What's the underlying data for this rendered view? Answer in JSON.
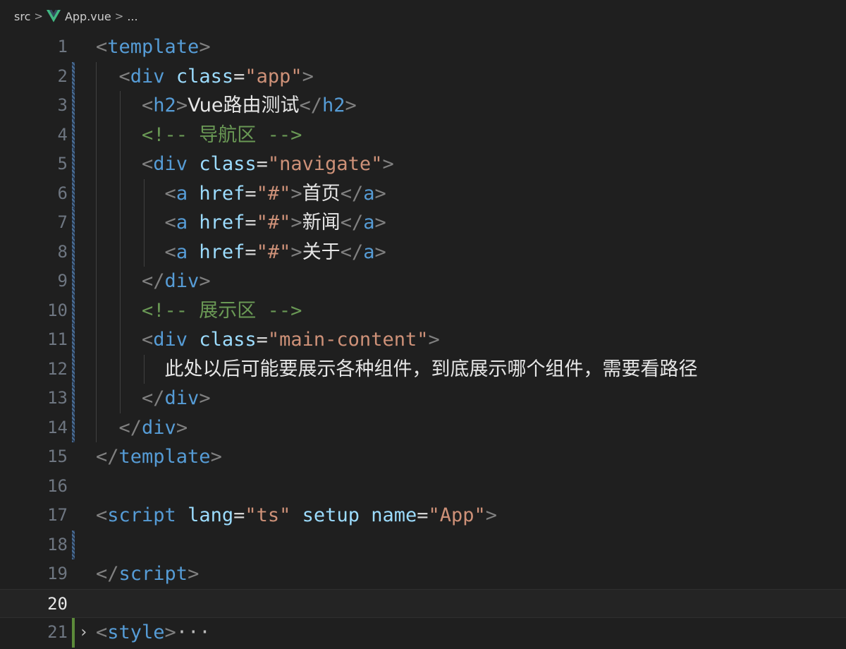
{
  "breadcrumb": {
    "folder": "src",
    "file": "App.vue",
    "more": "..."
  },
  "lines": [
    {
      "n": "1",
      "tokens": [
        [
          "br",
          "<"
        ],
        [
          "tag",
          "template"
        ],
        [
          "br",
          ">"
        ]
      ]
    },
    {
      "n": "2",
      "tokens": [
        [
          "sp",
          "  "
        ],
        [
          "br",
          "<"
        ],
        [
          "tag",
          "div"
        ],
        [
          "sp",
          " "
        ],
        [
          "attr",
          "class"
        ],
        [
          "eq",
          "="
        ],
        [
          "str",
          "\"app\""
        ],
        [
          "br",
          ">"
        ]
      ]
    },
    {
      "n": "3",
      "tokens": [
        [
          "sp",
          "    "
        ],
        [
          "br",
          "<"
        ],
        [
          "tag",
          "h2"
        ],
        [
          "br",
          ">"
        ],
        [
          "txt",
          "Vue路由测试"
        ],
        [
          "br",
          "</"
        ],
        [
          "tag",
          "h2"
        ],
        [
          "br",
          ">"
        ]
      ]
    },
    {
      "n": "4",
      "tokens": [
        [
          "sp",
          "    "
        ],
        [
          "cmt",
          "<!-- 导航区 -->"
        ]
      ]
    },
    {
      "n": "5",
      "tokens": [
        [
          "sp",
          "    "
        ],
        [
          "br",
          "<"
        ],
        [
          "tag",
          "div"
        ],
        [
          "sp",
          " "
        ],
        [
          "attr",
          "class"
        ],
        [
          "eq",
          "="
        ],
        [
          "str",
          "\"navigate\""
        ],
        [
          "br",
          ">"
        ]
      ]
    },
    {
      "n": "6",
      "tokens": [
        [
          "sp",
          "      "
        ],
        [
          "br",
          "<"
        ],
        [
          "tag",
          "a"
        ],
        [
          "sp",
          " "
        ],
        [
          "attr",
          "href"
        ],
        [
          "eq",
          "="
        ],
        [
          "str",
          "\"#\""
        ],
        [
          "br",
          ">"
        ],
        [
          "txt",
          "首页"
        ],
        [
          "br",
          "</"
        ],
        [
          "tag",
          "a"
        ],
        [
          "br",
          ">"
        ]
      ]
    },
    {
      "n": "7",
      "tokens": [
        [
          "sp",
          "      "
        ],
        [
          "br",
          "<"
        ],
        [
          "tag",
          "a"
        ],
        [
          "sp",
          " "
        ],
        [
          "attr",
          "href"
        ],
        [
          "eq",
          "="
        ],
        [
          "str",
          "\"#\""
        ],
        [
          "br",
          ">"
        ],
        [
          "txt",
          "新闻"
        ],
        [
          "br",
          "</"
        ],
        [
          "tag",
          "a"
        ],
        [
          "br",
          ">"
        ]
      ]
    },
    {
      "n": "8",
      "tokens": [
        [
          "sp",
          "      "
        ],
        [
          "br",
          "<"
        ],
        [
          "tag",
          "a"
        ],
        [
          "sp",
          " "
        ],
        [
          "attr",
          "href"
        ],
        [
          "eq",
          "="
        ],
        [
          "str",
          "\"#\""
        ],
        [
          "br",
          ">"
        ],
        [
          "txt",
          "关于"
        ],
        [
          "br",
          "</"
        ],
        [
          "tag",
          "a"
        ],
        [
          "br",
          ">"
        ]
      ]
    },
    {
      "n": "9",
      "tokens": [
        [
          "sp",
          "    "
        ],
        [
          "br",
          "</"
        ],
        [
          "tag",
          "div"
        ],
        [
          "br",
          ">"
        ]
      ]
    },
    {
      "n": "10",
      "tokens": [
        [
          "sp",
          "    "
        ],
        [
          "cmt",
          "<!-- 展示区 -->"
        ]
      ]
    },
    {
      "n": "11",
      "tokens": [
        [
          "sp",
          "    "
        ],
        [
          "br",
          "<"
        ],
        [
          "tag",
          "div"
        ],
        [
          "sp",
          " "
        ],
        [
          "attr",
          "class"
        ],
        [
          "eq",
          "="
        ],
        [
          "str",
          "\"main-content\""
        ],
        [
          "br",
          ">"
        ]
      ]
    },
    {
      "n": "12",
      "tokens": [
        [
          "sp",
          "      "
        ],
        [
          "txt",
          "此处以后可能要展示各种组件，到底展示哪个组件，需要看路径"
        ]
      ]
    },
    {
      "n": "13",
      "tokens": [
        [
          "sp",
          "    "
        ],
        [
          "br",
          "</"
        ],
        [
          "tag",
          "div"
        ],
        [
          "br",
          ">"
        ]
      ]
    },
    {
      "n": "14",
      "tokens": [
        [
          "sp",
          "  "
        ],
        [
          "br",
          "</"
        ],
        [
          "tag",
          "div"
        ],
        [
          "br",
          ">"
        ]
      ]
    },
    {
      "n": "15",
      "tokens": [
        [
          "br",
          "</"
        ],
        [
          "tag",
          "template"
        ],
        [
          "br",
          ">"
        ]
      ]
    },
    {
      "n": "16",
      "tokens": []
    },
    {
      "n": "17",
      "tokens": [
        [
          "br",
          "<"
        ],
        [
          "tag",
          "script"
        ],
        [
          "sp",
          " "
        ],
        [
          "attr",
          "lang"
        ],
        [
          "eq",
          "="
        ],
        [
          "str",
          "\"ts\""
        ],
        [
          "sp",
          " "
        ],
        [
          "attr",
          "setup"
        ],
        [
          "sp",
          " "
        ],
        [
          "attr",
          "name"
        ],
        [
          "eq",
          "="
        ],
        [
          "str",
          "\"App\""
        ],
        [
          "br",
          ">"
        ]
      ]
    },
    {
      "n": "18",
      "tokens": []
    },
    {
      "n": "19",
      "tokens": [
        [
          "br",
          "</"
        ],
        [
          "tag",
          "script"
        ],
        [
          "br",
          ">"
        ]
      ]
    },
    {
      "n": "20",
      "tokens": [],
      "active": true
    },
    {
      "n": "21",
      "tokens": [
        [
          "br",
          "<"
        ],
        [
          "tag",
          "style"
        ],
        [
          "br",
          ">"
        ],
        [
          "ell",
          "···"
        ]
      ],
      "folded": true
    }
  ],
  "colors": {
    "background": "#1f1f1f",
    "tag": "#569cd6",
    "attribute": "#9cdcfe",
    "string": "#ce9178",
    "comment": "#6a9955",
    "bracket": "#808080"
  }
}
